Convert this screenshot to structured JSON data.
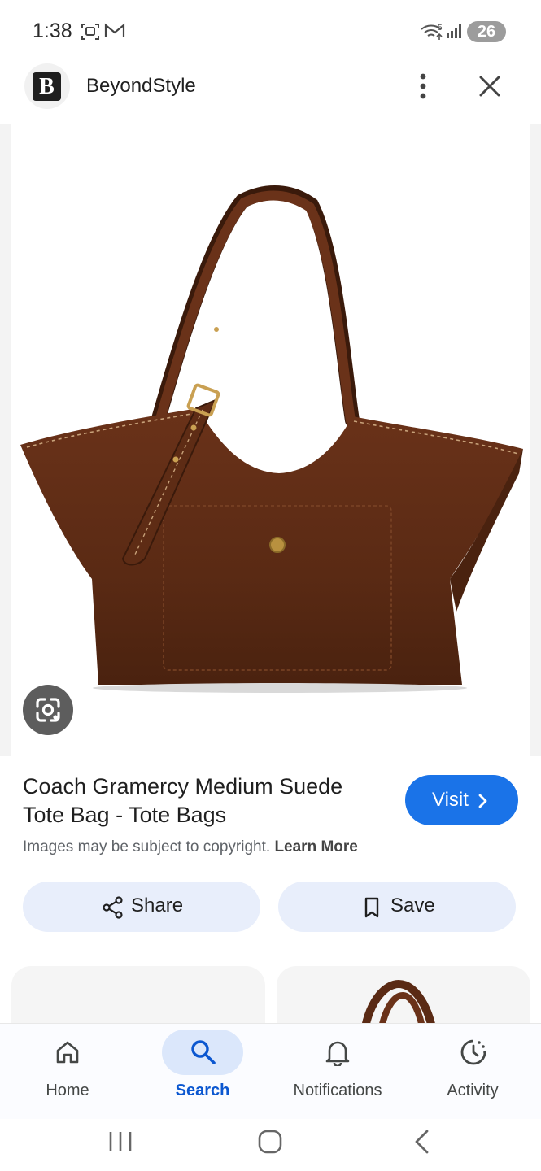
{
  "status_bar": {
    "time": "1:38",
    "battery": "26",
    "icons": [
      "screenshot-icon",
      "gmail-icon",
      "wifi-icon",
      "signal-icon"
    ]
  },
  "header": {
    "site_logo": "B",
    "site_name": "BeyondStyle",
    "icons": [
      "more-vert-icon",
      "close-icon"
    ]
  },
  "image": {
    "subject": "brown suede tote bag",
    "lens_icon": "google-lens-icon"
  },
  "result": {
    "title": "Coach Gramercy Medium Suede Tote Bag - Tote Bags",
    "visit_label": "Visit",
    "copyright_text": "Images may be subject to copyright.",
    "learn_more": "Learn More"
  },
  "actions": {
    "share_label": "Share",
    "save_label": "Save"
  },
  "bottom_nav": {
    "items": [
      {
        "label": "Home",
        "icon": "home-icon",
        "active": false
      },
      {
        "label": "Search",
        "icon": "search-icon",
        "active": true
      },
      {
        "label": "Notifications",
        "icon": "bell-icon",
        "active": false
      },
      {
        "label": "Activity",
        "icon": "activity-icon",
        "active": false
      }
    ]
  },
  "colors": {
    "accent": "#1a73e8",
    "chip_bg": "#e8eefb",
    "bag_brown": "#5a2a14"
  }
}
